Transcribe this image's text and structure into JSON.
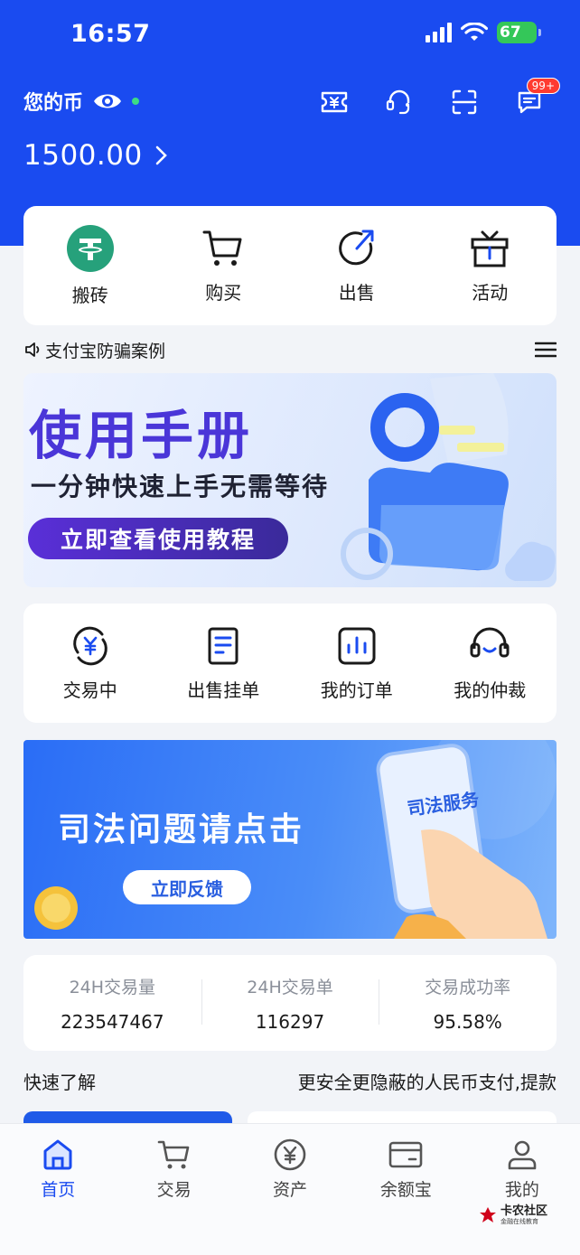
{
  "status_bar": {
    "time": "16:57",
    "battery": "67"
  },
  "header": {
    "coin_label": "您的币",
    "balance": "1500.00"
  },
  "top_actions": {
    "message_badge": "99+"
  },
  "main_actions": [
    {
      "label": "搬砖",
      "icon": "usdt-icon"
    },
    {
      "label": "购买",
      "icon": "cart-icon"
    },
    {
      "label": "出售",
      "icon": "sell-arrow-icon"
    },
    {
      "label": "活动",
      "icon": "gift-icon"
    }
  ],
  "notice": {
    "text": "支付宝防骗案例"
  },
  "banner_manual": {
    "title": "使用手册",
    "subtitle": "一分钟快速上手无需等待",
    "button": "立即查看使用教程"
  },
  "trade_actions": [
    {
      "label": "交易中",
      "icon": "yuan-cycle-icon"
    },
    {
      "label": "出售挂单",
      "icon": "document-icon"
    },
    {
      "label": "我的订单",
      "icon": "chart-icon"
    },
    {
      "label": "我的仲裁",
      "icon": "headset-icon"
    }
  ],
  "banner_legal": {
    "title": "司法问题请点击",
    "button": "立即反馈",
    "phone_text": "司法服务"
  },
  "stats": [
    {
      "label": "24H交易量",
      "value": "223547467"
    },
    {
      "label": "24H交易单",
      "value": "116297"
    },
    {
      "label": "交易成功率",
      "value": "95.58%"
    }
  ],
  "quick": {
    "title": "快速了解",
    "subtitle": "更安全更隐蔽的人民币支付,提款"
  },
  "tabbar": [
    {
      "label": "首页",
      "icon": "home-icon",
      "active": true
    },
    {
      "label": "交易",
      "icon": "cart-icon",
      "active": false
    },
    {
      "label": "资产",
      "icon": "yuan-circle-icon",
      "active": false
    },
    {
      "label": "余额宝",
      "icon": "wallet-icon",
      "active": false
    },
    {
      "label": "我的",
      "icon": "user-icon",
      "active": false
    }
  ],
  "watermark": {
    "main": "卡农社区",
    "small": "金融在线教育"
  },
  "colors": {
    "brand": "#1a4bf0",
    "usdt": "#26a17b",
    "badge": "#ff3b30"
  }
}
